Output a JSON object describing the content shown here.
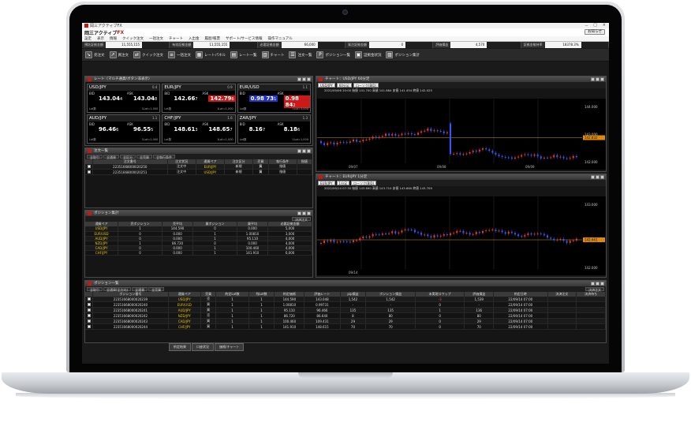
{
  "app": {
    "title": "岡三アクティブFX",
    "brand_prefix": "岡三アクティブ",
    "brand_suffix": "FX",
    "notice_button": "お知らせ"
  },
  "menu": [
    "設定",
    "表示",
    "情報",
    "クイック注文",
    "一括注文",
    "チャート",
    "入出金",
    "履歴/帳票",
    "サポート/サービス情報",
    "操作マニュアル"
  ],
  "account": [
    {
      "label": "預託証拠金額",
      "value": "11,555,155"
    },
    {
      "label": "有効証拠金額",
      "value": "11,555,155"
    },
    {
      "label": "必要証拠金額",
      "value": "66,000"
    },
    {
      "label": "発注証拠金額",
      "value": "0"
    },
    {
      "label": "評価損益",
      "value": "4,570"
    },
    {
      "label": "証拠金維持率",
      "value": "18378.3%"
    }
  ],
  "toolbar": [
    "売注文",
    "買注文",
    "クイック注文",
    "一括注文",
    "レートパネル",
    "レート一覧",
    "チャート",
    "注文一覧",
    "ポジション一覧",
    "証拠金状況",
    "ポジション集計"
  ],
  "rate_panel": {
    "title": "レート（マルチ通貨/ボタン非表示）",
    "bid_label": "BID",
    "ask_label": "ASK",
    "lot_label": "Lot数",
    "lot_unit": "1Lot=1,000",
    "rates": [
      {
        "pair": "USD/JPY",
        "spread": "0.4",
        "bid": "143.04",
        "bid_sup": "4",
        "ask": "143.04",
        "ask_sup": "8",
        "highlight": ""
      },
      {
        "pair": "EUR/JPY",
        "spread": "0.9",
        "bid": "142.66",
        "bid_sup": "7",
        "ask": "142.79",
        "ask_sup": "6",
        "highlight": "red"
      },
      {
        "pair": "EUR/USD",
        "spread": "1.1",
        "bid": "0.98 73",
        "bid_sup": "1",
        "ask": "0.98 84",
        "ask_sup": "2",
        "highlight": "both"
      },
      {
        "pair": "AUD/JPY",
        "spread": "1.1",
        "bid": "96.46",
        "bid_sup": "6",
        "ask": "96.55",
        "ask_sup": "5",
        "highlight": ""
      },
      {
        "pair": "CHF/JPY",
        "spread": "1.6",
        "bid": "148.61",
        "bid_sup": "3",
        "ask": "148.65",
        "ask_sup": "7",
        "highlight": ""
      },
      {
        "pair": "ZAR/JPY",
        "spread": "1.3",
        "bid": "8.16",
        "bid_sup": "7",
        "ask": "8.18",
        "ask_sup": "6",
        "highlight": ""
      }
    ]
  },
  "orders": {
    "title": "注文一覧",
    "filters": [
      "全取引",
      "全通貨",
      "全区分",
      "全売買",
      "全執行条件"
    ],
    "columns": [
      "注文番号",
      "注文状況",
      "通貨ペア",
      "注文区分",
      "売買",
      "執行条件",
      "指値"
    ],
    "rows": [
      {
        "id": "22351668000020250",
        "status": "注文中",
        "pair": "EUR/JPY",
        "type": "新規",
        "side": "買",
        "cond": "指値"
      },
      {
        "id": "22351668000020251",
        "status": "注文中",
        "pair": "USD/JPY",
        "type": "新規",
        "side": "買",
        "cond": "指値"
      }
    ]
  },
  "summary": {
    "title": "ポジション集計",
    "button": "決済注文",
    "columns": [
      "通貨ペア",
      "売ポジション",
      "売平均",
      "買ポジション",
      "買平均",
      "必要証拠金額"
    ],
    "rows": [
      {
        "pair": "USD/JPY",
        "sell": "1",
        "sell_avg": "144.590",
        "buy": "0",
        "buy_avg": "0.000",
        "margin": "5,000"
      },
      {
        "pair": "EUR/USD",
        "sell": "0",
        "sell_avg": "0.000",
        "buy": "1",
        "buy_avg": "1.00810",
        "margin": "3,000"
      },
      {
        "pair": "AUD/JPY",
        "sell": "0",
        "sell_avg": "0.000",
        "buy": "1",
        "buy_avg": "95.110",
        "margin": "4,000"
      },
      {
        "pair": "NZD/JPY",
        "sell": "1",
        "sell_avg": "86.720",
        "buy": "0",
        "buy_avg": "0.000",
        "margin": "4,000"
      },
      {
        "pair": "CAD/JPY",
        "sell": "0",
        "sell_avg": "0.000",
        "buy": "1",
        "buy_avg": "100.460",
        "margin": "4,000"
      },
      {
        "pair": "CHF/JPY",
        "sell": "0",
        "sell_avg": "0.000",
        "buy": "1",
        "buy_avg": "141.910",
        "margin": "6,000"
      }
    ]
  },
  "chart1": {
    "title": "チャート：USD/JPY 60分足",
    "pair": "USD/JPY",
    "interval": "60分足",
    "type": "ローソク(BID)",
    "ohlc": "2022/09/06 20:00  始値 141.700  高値 141.884  安値 141.454  終値 142.025",
    "ohlc2": "始値 143.100  高値 143.275  安値 143.000  終値 143.004",
    "price_levels": [
      "144.000",
      "143.000",
      "142.000"
    ],
    "current_price": "142.832",
    "dates": [
      "09/07",
      "09/08",
      "09/09"
    ]
  },
  "chart2": {
    "title": "チャート：EUR/JPY 1分足",
    "pair": "EUR/JPY",
    "interval": "1分足",
    "type": "ローソク(BID)",
    "ohlc": "2022/09/14 07:30  始値 143.690  高値 143.710  安値 143.660  終値 143.709",
    "ohlc2": "始値 142.700  高値 142.730  安値 142.610  終値 142.650",
    "price_levels": [
      "143.000",
      "142.000"
    ],
    "current_price": "142.661",
    "dates": [
      "09/14"
    ]
  },
  "positions": {
    "title": "ポジション一覧",
    "filters": [
      "全取引",
      "全通貨(全方向)",
      "全通貨",
      "全売買"
    ],
    "button": "決済注文",
    "columns": [
      "ポジション番号",
      "通貨ペア",
      "売買",
      "約定Lot数",
      "残Lot数",
      "約定価格",
      "評価レート",
      "pip損益",
      "ポジション損益",
      "未実現スワップ",
      "評価損益",
      "約定日時",
      "決済注文",
      "決済待ち"
    ],
    "rows": [
      {
        "id": "22351668000020239",
        "pair": "USD/JPY",
        "side": "売",
        "lot": "1",
        "remain": "1",
        "price": "144.590",
        "rate": "143.048",
        "pips": "1,542",
        "pl": "1,542",
        "swap": "-3",
        "eval": "1,539",
        "date": "22/09/14 07:00"
      },
      {
        "id": "22351668000020240",
        "pair": "EUR/USD",
        "side": "買",
        "lot": "1",
        "remain": "1",
        "price": "1.00810",
        "rate": "0.99731",
        "pips": "-",
        "pl": "-",
        "swap": "0",
        "eval": "-",
        "date": "22/09/14 07:00"
      },
      {
        "id": "22351668000020241",
        "pair": "AUD/JPY",
        "side": "買",
        "lot": "1",
        "remain": "1",
        "price": "95.110",
        "rate": "96.466",
        "pips": "135",
        "pl": "135",
        "swap": "1",
        "eval": "136",
        "date": "22/09/14 07:00"
      },
      {
        "id": "22351668000020242",
        "pair": "NZD/JPY",
        "side": "売",
        "lot": "1",
        "remain": "1",
        "price": "86.720",
        "rate": "86.640",
        "pips": "8",
        "pl": "80",
        "swap": "0",
        "eval": "80",
        "date": "22/09/14 07:00"
      },
      {
        "id": "22351668000020243",
        "pair": "CAD/JPY",
        "side": "買",
        "lot": "1",
        "remain": "1",
        "price": "100.460",
        "rate": "109.431",
        "pips": "29",
        "pl": "29",
        "swap": "0",
        "eval": "29",
        "date": "22/09/14 07:00"
      },
      {
        "id": "22351668000020244",
        "pair": "CHF/JPY",
        "side": "買",
        "lot": "1",
        "remain": "1",
        "price": "141.910",
        "rate": "148.615",
        "pips": "70",
        "pl": "70",
        "swap": "0",
        "eval": "70",
        "date": "22/09/14 07:00"
      }
    ]
  },
  "status_tabs": [
    "約定結果",
    "口座状況",
    "価格/チャート"
  ],
  "colors": {
    "accent": "#c21b17",
    "blue": "#2233cc",
    "yellow": "#e8c200",
    "panel": "#151515"
  }
}
